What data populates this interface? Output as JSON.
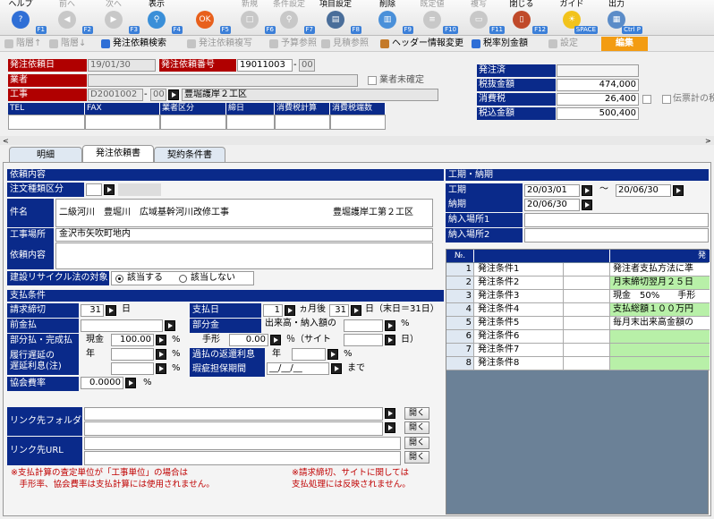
{
  "toolbar": {
    "items": [
      {
        "label": "ヘルプ",
        "key": "F1",
        "icon": "help-icon",
        "color": "#2f6fd6",
        "enabled": true
      },
      {
        "label": "前へ",
        "key": "F2",
        "icon": "arrow-left-icon",
        "color": "#9a9a9a",
        "enabled": false
      },
      {
        "label": "次へ",
        "key": "F3",
        "icon": "arrow-right-icon",
        "color": "#9a9a9a",
        "enabled": false
      },
      {
        "label": "表示",
        "key": "F4",
        "icon": "magnifier-icon",
        "color": "#3a8fd8",
        "enabled": true
      },
      {
        "label": "",
        "key": "F5",
        "icon": "ok-icon",
        "color": "#e8601c",
        "enabled": true
      },
      {
        "label": "新規",
        "key": "F6",
        "icon": "new-doc-icon",
        "color": "#bbbbbb",
        "enabled": false
      },
      {
        "label": "条件設定",
        "key": "F7",
        "icon": "condition-icon",
        "color": "#bbbbbb",
        "enabled": false
      },
      {
        "label": "項目設定",
        "key": "F8",
        "icon": "item-settings-icon",
        "color": "#4a6e9a",
        "enabled": true
      },
      {
        "label": "削除",
        "key": "F9",
        "icon": "trash-icon",
        "color": "#4a90d9",
        "enabled": true
      },
      {
        "label": "既定値",
        "key": "F10",
        "icon": "default-icon",
        "color": "#bbbbbb",
        "enabled": false
      },
      {
        "label": "複写",
        "key": "F11",
        "icon": "copy-icon",
        "color": "#bbbbbb",
        "enabled": false
      },
      {
        "label": "閉じる",
        "key": "F12",
        "icon": "close-door-icon",
        "color": "#c04a2a",
        "enabled": true
      },
      {
        "label": "ガイド",
        "key": "SPACE",
        "icon": "lightbulb-icon",
        "color": "#f2c31c",
        "enabled": true
      },
      {
        "label": "出力",
        "key": "Ctrl P",
        "icon": "printer-icon",
        "color": "#5b8cc8",
        "enabled": true
      }
    ]
  },
  "toolbar2": {
    "items": [
      {
        "label": "階層↑",
        "enabled": false
      },
      {
        "label": "階層↓",
        "enabled": false
      },
      {
        "label": "発注依頼検索",
        "enabled": true
      },
      {
        "label": "発注依頼複写",
        "enabled": false
      },
      {
        "label": "予算参照",
        "enabled": false
      },
      {
        "label": "見積参照",
        "enabled": false
      },
      {
        "label": "ヘッダー情報変更",
        "enabled": true
      },
      {
        "label": "税率別金額",
        "enabled": true
      },
      {
        "label": "設定",
        "enabled": false
      }
    ],
    "edit_label": "編集"
  },
  "header": {
    "order_date_label": "発注依頼日",
    "order_date": "19/01/30",
    "order_no_label": "発注依頼番号",
    "order_no": "19011003",
    "order_sub": "00",
    "vendor_label": "業者",
    "vendor_undetermined": "業者未確定",
    "work_label": "工事",
    "work_code": "D2001002",
    "work_sub": "00",
    "work_name": "豊堀護岸２工区",
    "columns": [
      "TEL",
      "FAX",
      "業者区分",
      "締日",
      "消費税計算",
      "消費税端数"
    ],
    "ordered_label": "発注済",
    "pretax_label": "税抜金額",
    "pretax": "474,000",
    "tax_label": "消費税",
    "tax": "26,400",
    "slip_tax": "伝票計の税",
    "total_label": "税込金額",
    "total": "500,400"
  },
  "tabs": [
    "明細",
    "発注依頼書",
    "契約条件書"
  ],
  "form": {
    "section1": "依頼内容",
    "order_kind_label": "注文種類区分",
    "subject_label": "件名",
    "subject": "二級河川　豊堀川　広域基幹河川改修工事",
    "subject_right": "豊堀護岸工第２工区",
    "site_label": "工事場所",
    "site": "金沢市矢吹町地内",
    "content_label": "依頼内容",
    "recycle_label": "建設リサイクル法の対象",
    "recycle_yes": "該当する",
    "recycle_no": "該当しない",
    "section2": "支払条件",
    "closing_label": "請求締切",
    "closing_day": "31",
    "day_unit": "日",
    "payday_label": "支払日",
    "pay_month": "1",
    "month_after": "ヵ月後",
    "pay_day": "31",
    "pay_day_note": "日（末日＝31日）",
    "advance_label": "前金払",
    "partial_label": "部分金",
    "partial_note": "出来高・納入額の",
    "pct": "%",
    "partial_done_label": "部分払・完成払",
    "cash_label": "現金",
    "cash_pct": "100.00",
    "bill_label": "手形",
    "bill_pct": "0.00",
    "site_note": "％（サイト",
    "site_close": "日）",
    "delay_label": "履行遅延の\n遅延利息(注)",
    "year_label": "年",
    "overpay_label": "過払の返還利息",
    "warranty_label": "瑕疵担保期間",
    "warranty_date": "__/__/__",
    "until": "まで",
    "assoc_label": "協会費率",
    "assoc_rate": "0.0000",
    "link_folder_label": "リンク先フォルダー",
    "link_url_label": "リンク先URL",
    "open_label": "開く",
    "note_left": "※支払計算の査定単位が「工事単位」の場合は\n　手形率、協会費率は支払計算には使用されません。",
    "note_right": "※請求締切、サイトに関しては\n支払処理には反映されません。"
  },
  "schedule": {
    "section": "工期・納期",
    "period_label": "工期",
    "period_from": "20/03/01",
    "tilde": "〜",
    "period_to": "20/06/30",
    "due_label": "納期",
    "due": "20/06/30",
    "deliv1_label": "納入場所1",
    "deliv2_label": "納入場所2"
  },
  "conditions": {
    "no_header": "№.",
    "content_header": "発",
    "rows": [
      {
        "no": "1",
        "name": "発注条件1",
        "content": "発注者支払方法に準"
      },
      {
        "no": "2",
        "name": "発注条件2",
        "content": "月末締切翌月２５日"
      },
      {
        "no": "3",
        "name": "発注条件3",
        "content": "現金　50%　　手形"
      },
      {
        "no": "4",
        "name": "発注条件4",
        "content": "支払総額１００万円"
      },
      {
        "no": "5",
        "name": "発注条件5",
        "content": "毎月末出来高金額の"
      },
      {
        "no": "6",
        "name": "発注条件6",
        "content": ""
      },
      {
        "no": "7",
        "name": "発注条件7",
        "content": ""
      },
      {
        "no": "8",
        "name": "発注条件8",
        "content": ""
      }
    ],
    "green": "#b8f0a8"
  }
}
